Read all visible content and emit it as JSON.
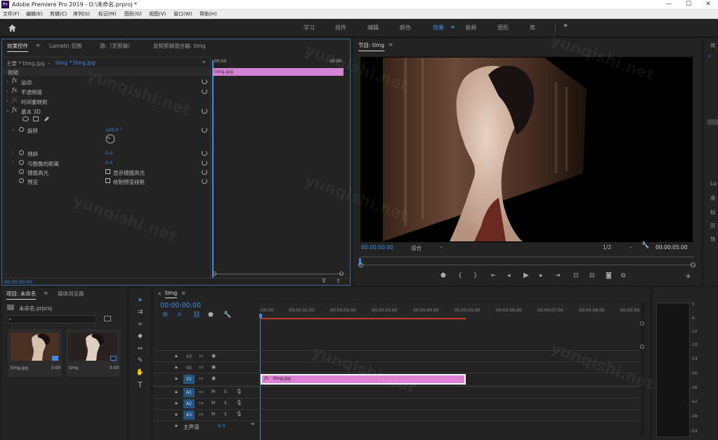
{
  "window": {
    "title": "Adobe Premiere Pro 2019 - D:\\未命名.prproj *",
    "app_icon": "Pr"
  },
  "menu": [
    "文件(F)",
    "编辑(E)",
    "剪辑(C)",
    "序列(S)",
    "标记(M)",
    "图形(G)",
    "视图(V)",
    "窗口(W)",
    "帮助(H)"
  ],
  "workspaces": {
    "items": [
      "学习",
      "组件",
      "编辑",
      "颜色",
      "效果",
      "音频",
      "图形",
      "库"
    ],
    "active": "效果",
    "more": "»"
  },
  "effect_controls": {
    "tabs": [
      "效果控件",
      "Lumetri 范围",
      "源:（无剪辑）",
      "音频剪辑混合器: timg"
    ],
    "source_label": "主要 * timg.jpg",
    "clip_link": "timg * timg.jpg",
    "section_video": "视频",
    "mini_time_start": ":00:00",
    "mini_time_end": "00:00",
    "mini_clip": "timg.jpg",
    "effects": {
      "motion": "运动",
      "opacity": "不透明度",
      "time_remap": "时间重映射",
      "basic3d": "基本 3D"
    },
    "props": {
      "swivel": "旋转",
      "swivel_val": "120.0 °",
      "tilt": "倾斜",
      "tilt_val": "0.0",
      "distance": "与图像的距离",
      "distance_val": "0.0",
      "specular": "镜面高光",
      "specular_cb": "显示镜面高光",
      "preview": "预览",
      "preview_cb": "绘制预览线框"
    },
    "timecode": "00:00:00:00"
  },
  "program": {
    "title": "节目: timg",
    "timecode": "00:00:00:00",
    "fit": "适合",
    "resolution": "1/2",
    "duration": "00:00:05:00"
  },
  "project": {
    "tabs": [
      "项目: 未命名",
      "媒体浏览器"
    ],
    "file": "未命名.prproj",
    "items": [
      {
        "name": "timg.jpg",
        "dur": "5:00"
      },
      {
        "name": "timg",
        "dur": "5:00"
      }
    ]
  },
  "timeline": {
    "tab": "timg",
    "timecode": "00:00:00:00",
    "ruler": [
      ":00:00",
      "00:00:01:00",
      "00:00:02:00",
      "00:00:03:00",
      "00:00:04:00",
      "00:00:05:00",
      "00:00:06:00",
      "00:00:07:00",
      "00:00:08:00",
      "00:00:09:"
    ],
    "video_tracks": [
      "V3",
      "V2",
      "V1"
    ],
    "audio_tracks": [
      "A1",
      "A2",
      "A3"
    ],
    "master": "主声道",
    "master_val": "0.0",
    "clip": "timg.jpg",
    "clip_color": "#e07fd6"
  },
  "meter": {
    "scale": [
      "0",
      "-6",
      "-12",
      "-18",
      "-24",
      "-30",
      "-36",
      "-42",
      "-48",
      "-54"
    ]
  },
  "right_panel": {
    "tab": "效",
    "items": [
      "Lu",
      "库",
      "标",
      "历",
      "信"
    ]
  },
  "watermark": "yunqishi.net"
}
